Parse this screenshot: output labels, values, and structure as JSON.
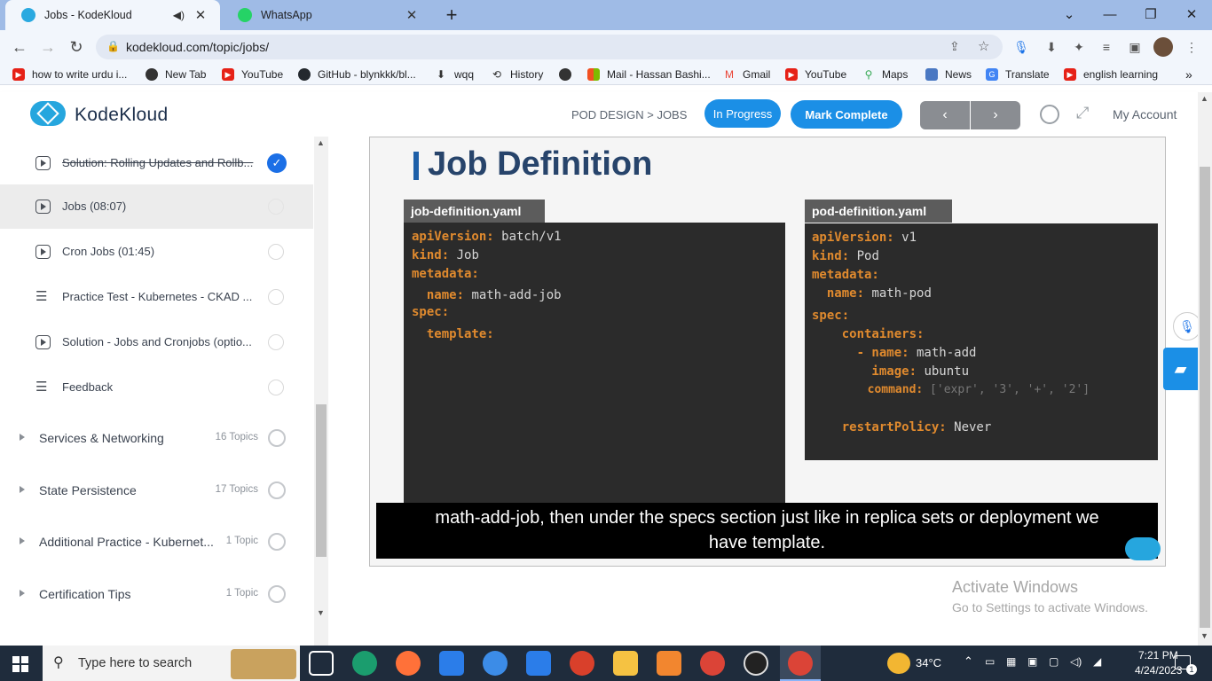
{
  "browser": {
    "tabs": [
      {
        "title": "Jobs - KodeKloud",
        "active": true
      },
      {
        "title": "WhatsApp",
        "active": false
      }
    ],
    "url": "kodekloud.com/topic/jobs/",
    "bookmarks": [
      "how to write urdu i...",
      "New Tab",
      "YouTube",
      "GitHub - blynkkk/bl...",
      "wqq",
      "History",
      "Mail - Hassan Bashi...",
      "Gmail",
      "YouTube",
      "Maps",
      "News",
      "Translate",
      "english learning"
    ]
  },
  "header": {
    "logo": "KodeKloud",
    "breadcrumb": "POD DESIGN > JOBS",
    "status_button": "In Progress",
    "complete_button": "Mark Complete",
    "account": "My Account"
  },
  "sidebar": {
    "lessons": [
      {
        "label": "Solution: Rolling Updates and Rollb...",
        "type": "video",
        "done": true
      },
      {
        "label": "Jobs (08:07)",
        "type": "video",
        "done": false,
        "current": true
      },
      {
        "label": "Cron Jobs (01:45)",
        "type": "video",
        "done": false
      },
      {
        "label": "Practice Test - Kubernetes - CKAD ...",
        "type": "text",
        "done": false
      },
      {
        "label": "Solution - Jobs and Cronjobs (optio...",
        "type": "video",
        "done": false
      },
      {
        "label": "Feedback",
        "type": "text",
        "done": false
      }
    ],
    "sections": [
      {
        "label": "Services & Networking",
        "count": "16 Topics"
      },
      {
        "label": "State Persistence",
        "count": "17 Topics"
      },
      {
        "label": "Additional Practice - Kubernet...",
        "count": "1 Topic"
      },
      {
        "label": "Certification Tips",
        "count": "1 Topic"
      }
    ]
  },
  "video": {
    "slide_title": "Job Definition",
    "left_file": "job-definition.yaml",
    "right_file": "pod-definition.yaml",
    "left_code": [
      {
        "k": "apiVersion:",
        "v": " batch/v1"
      },
      {
        "k": "kind:",
        "v": " Job"
      },
      {
        "k": "metadata:",
        "v": ""
      },
      {
        "k": "  name:",
        "v": " math-add-job"
      },
      {
        "k": "spec:",
        "v": ""
      },
      {
        "k": "  template:",
        "v": ""
      }
    ],
    "right_code": [
      {
        "k": "apiVersion:",
        "v": " v1"
      },
      {
        "k": "kind:",
        "v": " Pod"
      },
      {
        "k": "metadata:",
        "v": ""
      },
      {
        "k": "  name:",
        "v": " math-pod"
      },
      {
        "k": "spec:",
        "v": ""
      },
      {
        "k": "    containers:",
        "v": ""
      },
      {
        "k": "      - name:",
        "v": " math-add"
      },
      {
        "k": "        image:",
        "v": " ubuntu"
      },
      {
        "k": "        command:",
        "v": " ['expr', '3', '+', '2']"
      },
      {
        "k": "",
        "v": ""
      },
      {
        "k": "    restartPolicy:",
        "v": " Never"
      }
    ],
    "caption_line1": "math-add-job, then under the specs section just like in replica sets or deployment we",
    "caption_line2": "have template."
  },
  "watermark": {
    "line1": "Activate Windows",
    "line2": "Go to Settings to activate Windows."
  },
  "taskbar": {
    "search_placeholder": "Type here to search",
    "temperature": "34°C",
    "time": "7:21 PM",
    "date": "4/24/2023",
    "notification_count": "1"
  }
}
